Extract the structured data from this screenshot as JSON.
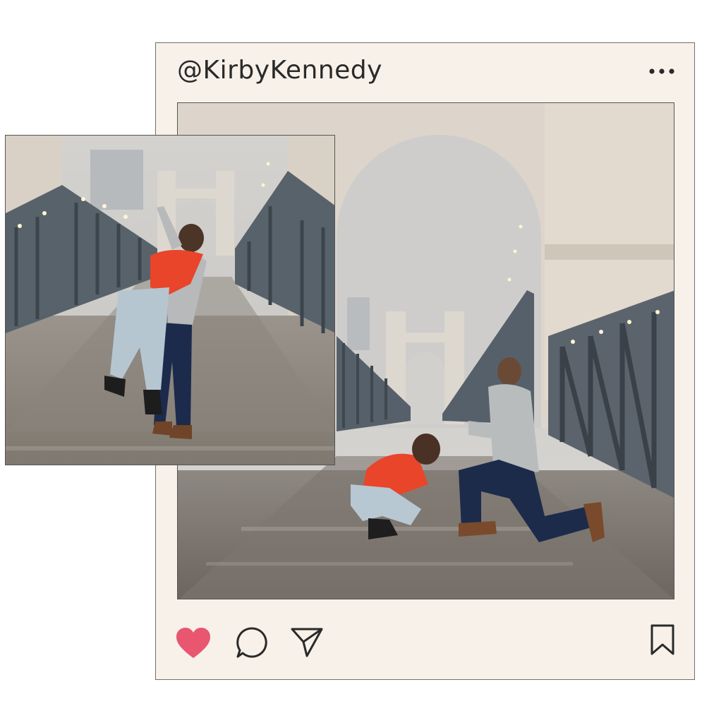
{
  "post": {
    "username": "@KirbyKennedy",
    "liked": true
  },
  "colors": {
    "card_background": "#f7f1ea",
    "heart_fill": "#e8566f",
    "icon_stroke": "#2a2a2a",
    "jacket_orange": "#e8452a",
    "bridge_steel": "#4d565e"
  },
  "icons": {
    "more": "more-horizontal-icon",
    "like": "heart-icon",
    "comment": "comment-icon",
    "share": "send-icon",
    "save": "bookmark-icon"
  },
  "photos": {
    "main": "couple-proposal-on-bridge",
    "secondary": "couple-embrace-on-bridge"
  }
}
